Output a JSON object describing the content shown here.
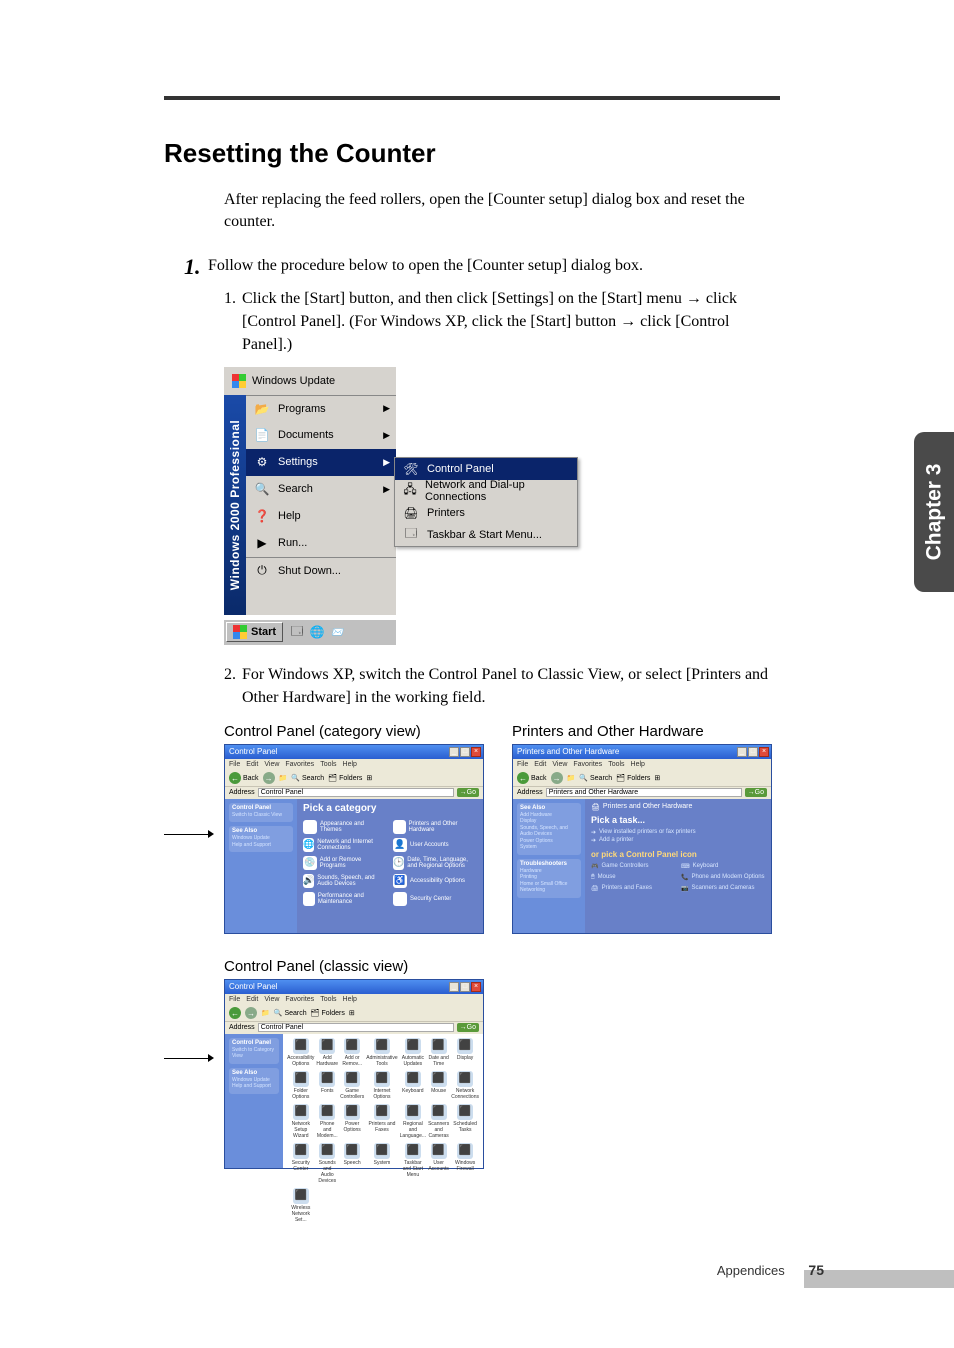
{
  "page": {
    "chapter_tab": "Chapter 3",
    "footer_section": "Appendices",
    "footer_page": "75"
  },
  "title": "Resetting the Counter",
  "intro": "After replacing the feed rollers, open the [Counter setup] dialog box and reset the counter.",
  "step_major_1": "Follow the procedure below to open the [Counter setup] dialog box.",
  "sub_step_1": "Click the [Start] button, and then click [Settings] on the [Start] menu → click [Control Panel]. (For Windows XP, click the [Start] button → click [Control Panel].)",
  "sub_step_2": "For Windows XP, switch the Control Panel to Classic View, or select [Printers and Other Hardware] in the working field.",
  "captions": {
    "cp_category": "Control Panel (category view)",
    "poh": "Printers and Other Hardware",
    "cp_classic": "Control Panel (classic view)"
  },
  "start_menu": {
    "os_strip": "Windows 2000 Professional",
    "top_item": "Windows Update",
    "items": [
      {
        "label": "Programs",
        "icon": "📂",
        "expand": true
      },
      {
        "label": "Documents",
        "icon": "📄",
        "expand": true
      },
      {
        "label": "Settings",
        "icon": "⚙",
        "expand": true,
        "selected": true
      },
      {
        "label": "Search",
        "icon": "🔍",
        "expand": true
      },
      {
        "label": "Help",
        "icon": "❓",
        "expand": false
      },
      {
        "label": "Run...",
        "icon": "▶",
        "expand": false
      },
      {
        "label": "Shut Down...",
        "icon": "⏻",
        "expand": false
      }
    ],
    "submenu": [
      {
        "label": "Control Panel",
        "icon": "🛠",
        "selected": true
      },
      {
        "label": "Network and Dial-up Connections",
        "icon": "🖧"
      },
      {
        "label": "Printers",
        "icon": "🖨"
      },
      {
        "label": "Taskbar & Start Menu...",
        "icon": "🗔"
      }
    ],
    "start_button": "Start"
  },
  "cp_window": {
    "title": "Control Panel",
    "menus": [
      "File",
      "Edit",
      "View",
      "Favorites",
      "Tools",
      "Help"
    ],
    "toolbar": {
      "back": "Back",
      "search": "Search",
      "folders": "Folders"
    },
    "address_label": "Address",
    "address_value": "Control Panel",
    "go": "Go",
    "side_panel1_title": "Control Panel",
    "side_panel1_link": "Switch to Classic View",
    "side_panel2_title": "See Also",
    "side_panel2_links": [
      "Windows Update",
      "Help and Support"
    ],
    "heading": "Pick a category",
    "categories": [
      "Appearance and Themes",
      "Printers and Other Hardware",
      "Network and Internet Connections",
      "User Accounts",
      "Add or Remove Programs",
      "Date, Time, Language, and Regional Options",
      "Sounds, Speech, and Audio Devices",
      "Accessibility Options",
      "Performance and Maintenance",
      "Security Center"
    ]
  },
  "poh_window": {
    "title": "Printers and Other Hardware",
    "crumb": "Printers and Other Hardware",
    "side_panel1_title": "See Also",
    "side_panel1_links": [
      "Add Hardware",
      "Display",
      "Sounds, Speech, and Audio Devices",
      "Power Options",
      "System"
    ],
    "side_panel2_title": "Troubleshooters",
    "side_panel2_links": [
      "Hardware",
      "Printing",
      "Home or Small Office Networking"
    ],
    "task_heading": "Pick a task...",
    "tasks": [
      "View installed printers or fax printers",
      "Add a printer"
    ],
    "icon_heading": "or pick a Control Panel icon",
    "icons": [
      "Game Controllers",
      "Keyboard",
      "Mouse",
      "Phone and Modem Options",
      "Printers and Faxes",
      "Scanners and Cameras"
    ]
  },
  "cp_classic": {
    "title": "Control Panel",
    "side_panel1_title": "Control Panel",
    "side_panel1_link": "Switch to Category View",
    "side_panel2_title": "See Also",
    "side_panel2_links": [
      "Windows Update",
      "Help and Support"
    ],
    "icons": [
      "Accessibility Options",
      "Add Hardware",
      "Add or Remov...",
      "Administrative Tools",
      "Automatic Updates",
      "Date and Time",
      "Display",
      "Folder Options",
      "Fonts",
      "Game Controllers",
      "Internet Options",
      "Keyboard",
      "Mouse",
      "Network Connections",
      "Network Setup Wizard",
      "Phone and Modem...",
      "Power Options",
      "Printers and Faxes",
      "Regional and Language...",
      "Scanners and Cameras",
      "Scheduled Tasks",
      "Security Center",
      "Sounds and Audio Devices",
      "Speech",
      "System",
      "Taskbar and Start Menu",
      "User Accounts",
      "Windows Firewall",
      "Wireless Network Set..."
    ]
  }
}
